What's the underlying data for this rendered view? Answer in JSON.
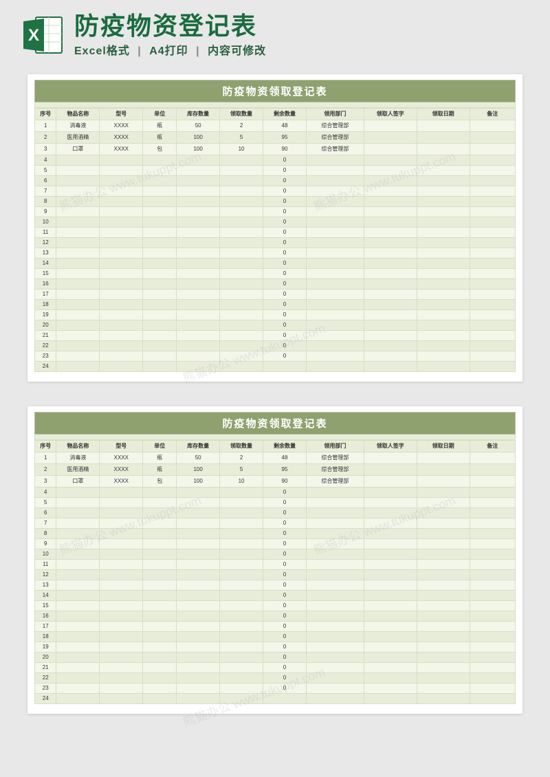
{
  "watermark": "熊猫办公 www.tukuppt.com",
  "header": {
    "title": "防疫物资登记表",
    "sub_parts": [
      "Excel格式",
      "A4打印",
      "内容可修改"
    ],
    "separator": "|"
  },
  "sheet": {
    "title": "防疫物资领取登记表",
    "columns": [
      "序号",
      "物品名称",
      "型号",
      "单位",
      "库存数量",
      "领取数量",
      "剩余数量",
      "领用部门",
      "领取人签字",
      "领取日期",
      "备注"
    ],
    "rows": [
      {
        "seq": "1",
        "name": "消毒液",
        "model": "XXXX",
        "unit": "瓶",
        "stock": "50",
        "take": "2",
        "remain": "48",
        "dept": "综合管理部",
        "sign": "",
        "date": "",
        "remark": ""
      },
      {
        "seq": "2",
        "name": "医用酒精",
        "model": "XXXX",
        "unit": "瓶",
        "stock": "100",
        "take": "5",
        "remain": "95",
        "dept": "综合管理部",
        "sign": "",
        "date": "",
        "remark": ""
      },
      {
        "seq": "3",
        "name": "口罩",
        "model": "XXXX",
        "unit": "包",
        "stock": "100",
        "take": "10",
        "remain": "90",
        "dept": "综合管理部",
        "sign": "",
        "date": "",
        "remark": ""
      },
      {
        "seq": "4",
        "name": "",
        "model": "",
        "unit": "",
        "stock": "",
        "take": "",
        "remain": "0",
        "dept": "",
        "sign": "",
        "date": "",
        "remark": ""
      },
      {
        "seq": "5",
        "name": "",
        "model": "",
        "unit": "",
        "stock": "",
        "take": "",
        "remain": "0",
        "dept": "",
        "sign": "",
        "date": "",
        "remark": ""
      },
      {
        "seq": "6",
        "name": "",
        "model": "",
        "unit": "",
        "stock": "",
        "take": "",
        "remain": "0",
        "dept": "",
        "sign": "",
        "date": "",
        "remark": ""
      },
      {
        "seq": "7",
        "name": "",
        "model": "",
        "unit": "",
        "stock": "",
        "take": "",
        "remain": "0",
        "dept": "",
        "sign": "",
        "date": "",
        "remark": ""
      },
      {
        "seq": "8",
        "name": "",
        "model": "",
        "unit": "",
        "stock": "",
        "take": "",
        "remain": "0",
        "dept": "",
        "sign": "",
        "date": "",
        "remark": ""
      },
      {
        "seq": "9",
        "name": "",
        "model": "",
        "unit": "",
        "stock": "",
        "take": "",
        "remain": "0",
        "dept": "",
        "sign": "",
        "date": "",
        "remark": ""
      },
      {
        "seq": "10",
        "name": "",
        "model": "",
        "unit": "",
        "stock": "",
        "take": "",
        "remain": "0",
        "dept": "",
        "sign": "",
        "date": "",
        "remark": ""
      },
      {
        "seq": "11",
        "name": "",
        "model": "",
        "unit": "",
        "stock": "",
        "take": "",
        "remain": "0",
        "dept": "",
        "sign": "",
        "date": "",
        "remark": ""
      },
      {
        "seq": "12",
        "name": "",
        "model": "",
        "unit": "",
        "stock": "",
        "take": "",
        "remain": "0",
        "dept": "",
        "sign": "",
        "date": "",
        "remark": ""
      },
      {
        "seq": "13",
        "name": "",
        "model": "",
        "unit": "",
        "stock": "",
        "take": "",
        "remain": "0",
        "dept": "",
        "sign": "",
        "date": "",
        "remark": ""
      },
      {
        "seq": "14",
        "name": "",
        "model": "",
        "unit": "",
        "stock": "",
        "take": "",
        "remain": "0",
        "dept": "",
        "sign": "",
        "date": "",
        "remark": ""
      },
      {
        "seq": "15",
        "name": "",
        "model": "",
        "unit": "",
        "stock": "",
        "take": "",
        "remain": "0",
        "dept": "",
        "sign": "",
        "date": "",
        "remark": ""
      },
      {
        "seq": "16",
        "name": "",
        "model": "",
        "unit": "",
        "stock": "",
        "take": "",
        "remain": "0",
        "dept": "",
        "sign": "",
        "date": "",
        "remark": ""
      },
      {
        "seq": "17",
        "name": "",
        "model": "",
        "unit": "",
        "stock": "",
        "take": "",
        "remain": "0",
        "dept": "",
        "sign": "",
        "date": "",
        "remark": ""
      },
      {
        "seq": "18",
        "name": "",
        "model": "",
        "unit": "",
        "stock": "",
        "take": "",
        "remain": "0",
        "dept": "",
        "sign": "",
        "date": "",
        "remark": ""
      },
      {
        "seq": "19",
        "name": "",
        "model": "",
        "unit": "",
        "stock": "",
        "take": "",
        "remain": "0",
        "dept": "",
        "sign": "",
        "date": "",
        "remark": ""
      },
      {
        "seq": "20",
        "name": "",
        "model": "",
        "unit": "",
        "stock": "",
        "take": "",
        "remain": "0",
        "dept": "",
        "sign": "",
        "date": "",
        "remark": ""
      },
      {
        "seq": "21",
        "name": "",
        "model": "",
        "unit": "",
        "stock": "",
        "take": "",
        "remain": "0",
        "dept": "",
        "sign": "",
        "date": "",
        "remark": ""
      },
      {
        "seq": "22",
        "name": "",
        "model": "",
        "unit": "",
        "stock": "",
        "take": "",
        "remain": "0",
        "dept": "",
        "sign": "",
        "date": "",
        "remark": ""
      },
      {
        "seq": "23",
        "name": "",
        "model": "",
        "unit": "",
        "stock": "",
        "take": "",
        "remain": "0",
        "dept": "",
        "sign": "",
        "date": "",
        "remark": ""
      },
      {
        "seq": "24",
        "name": "",
        "model": "",
        "unit": "",
        "stock": "",
        "take": "",
        "remain": "",
        "dept": "",
        "sign": "",
        "date": "",
        "remark": ""
      }
    ]
  }
}
